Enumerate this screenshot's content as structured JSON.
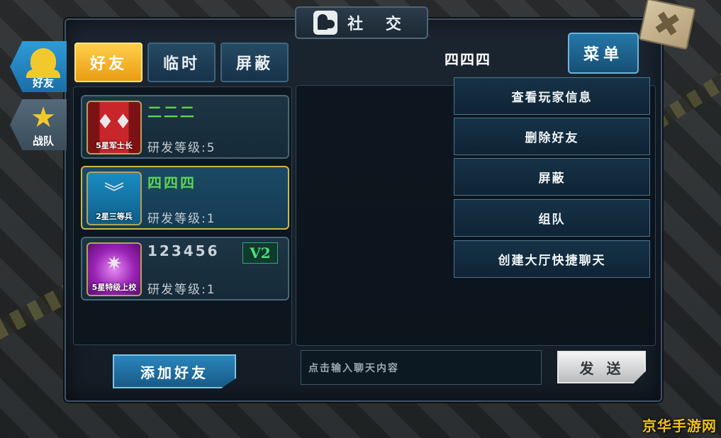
{
  "title": "社 交",
  "close_label": "✖",
  "side_tabs": [
    {
      "label": "好友",
      "active": true
    },
    {
      "label": "战队",
      "active": false
    }
  ],
  "filter_tabs": [
    {
      "label": "好友",
      "active": true
    },
    {
      "label": "临时",
      "active": false
    },
    {
      "label": "屏蔽",
      "active": false
    }
  ],
  "friends": [
    {
      "name": "二二二",
      "rank": "5星军士长",
      "level": "研发等级:5",
      "selected": false,
      "vip": ""
    },
    {
      "name": "四四四",
      "rank": "2星三等兵",
      "level": "研发等级:1",
      "selected": true,
      "vip": ""
    },
    {
      "name": "123456",
      "rank": "5星特级上校",
      "level": "研发等级:1",
      "selected": false,
      "vip": "V2"
    }
  ],
  "chat": {
    "target": "四四四",
    "menu_label": "菜单",
    "input_placeholder": "点击输入聊天内容",
    "send_label": "发送"
  },
  "menu_items": [
    "查看玩家信息",
    "删除好友",
    "屏蔽",
    "组队",
    "创建大厅快捷聊天"
  ],
  "add_friend_label": "添加好友",
  "watermark": "京华手游网",
  "colors": {
    "active_tab": "#f2b42a",
    "selected_border": "#c9b94a",
    "name_green": "#5bd64e",
    "accent_blue": "#2577a8"
  }
}
